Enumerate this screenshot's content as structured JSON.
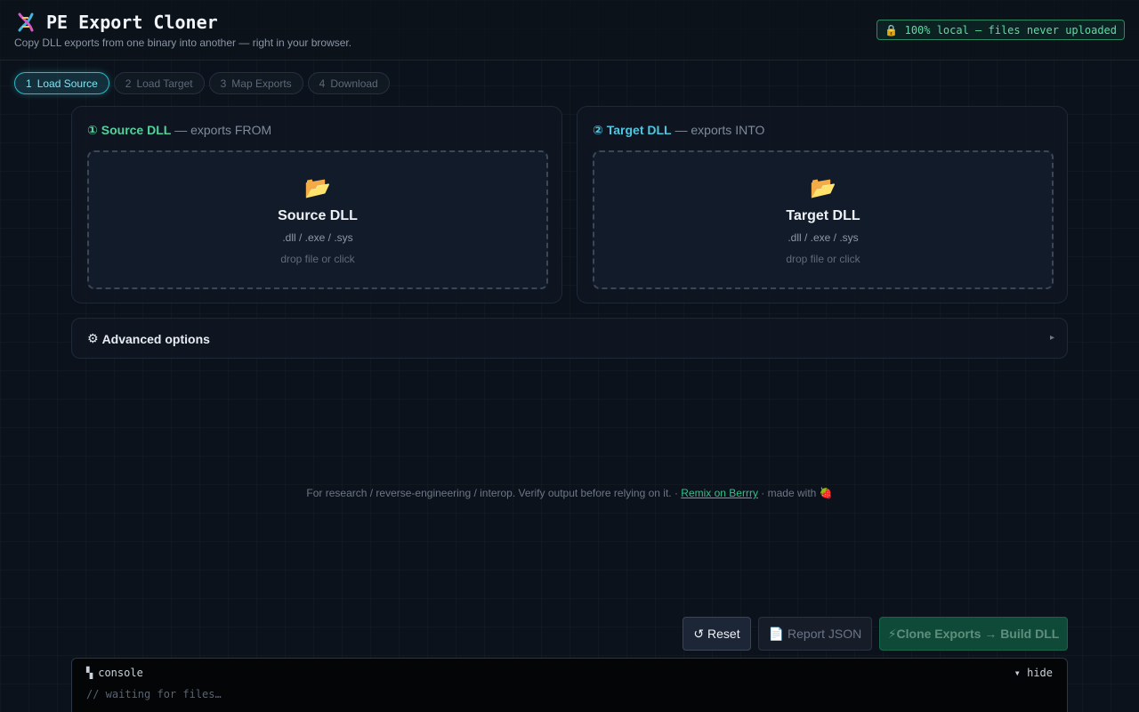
{
  "header": {
    "title": "PE Export Cloner",
    "subtitle": "Copy DLL exports from one binary into another — right in your browser.",
    "badge": "🔒 100% local — files never uploaded"
  },
  "steps": [
    {
      "num": "1",
      "label": "Load Source",
      "active": true
    },
    {
      "num": "2",
      "label": "Load Target",
      "active": false
    },
    {
      "num": "3",
      "label": "Map Exports",
      "active": false
    },
    {
      "num": "4",
      "label": "Download",
      "active": false
    }
  ],
  "source": {
    "num": "①",
    "name": "Source DLL",
    "rest": " — exports FROM",
    "dz_title": "Source DLL",
    "dz_types": ".dll / .exe / .sys",
    "dz_hint": "drop file or click"
  },
  "target": {
    "num": "②",
    "name": "Target DLL",
    "rest": " — exports INTO",
    "dz_title": "Target DLL",
    "dz_types": ".dll / .exe / .sys",
    "dz_hint": "drop file or click"
  },
  "advanced": {
    "icon": "⚙",
    "label": "Advanced options",
    "arrow": "▸"
  },
  "footer": {
    "text": "For research / reverse-engineering / interop. Verify output before relying on it. · ",
    "link": "Remix on Berrry",
    "suffix": " · made with 🍓"
  },
  "actions": {
    "reset": "↺ Reset",
    "report": "📄 Report JSON",
    "clone": "⚡Clone Exports → Build DLL"
  },
  "console": {
    "icon": "▚",
    "title": "console",
    "toggle": "▾ hide",
    "line": "// waiting for files…"
  },
  "colors": {
    "accent_green": "#4fd39a",
    "accent_cyan": "#4fc6df",
    "background": "#0c121b"
  }
}
